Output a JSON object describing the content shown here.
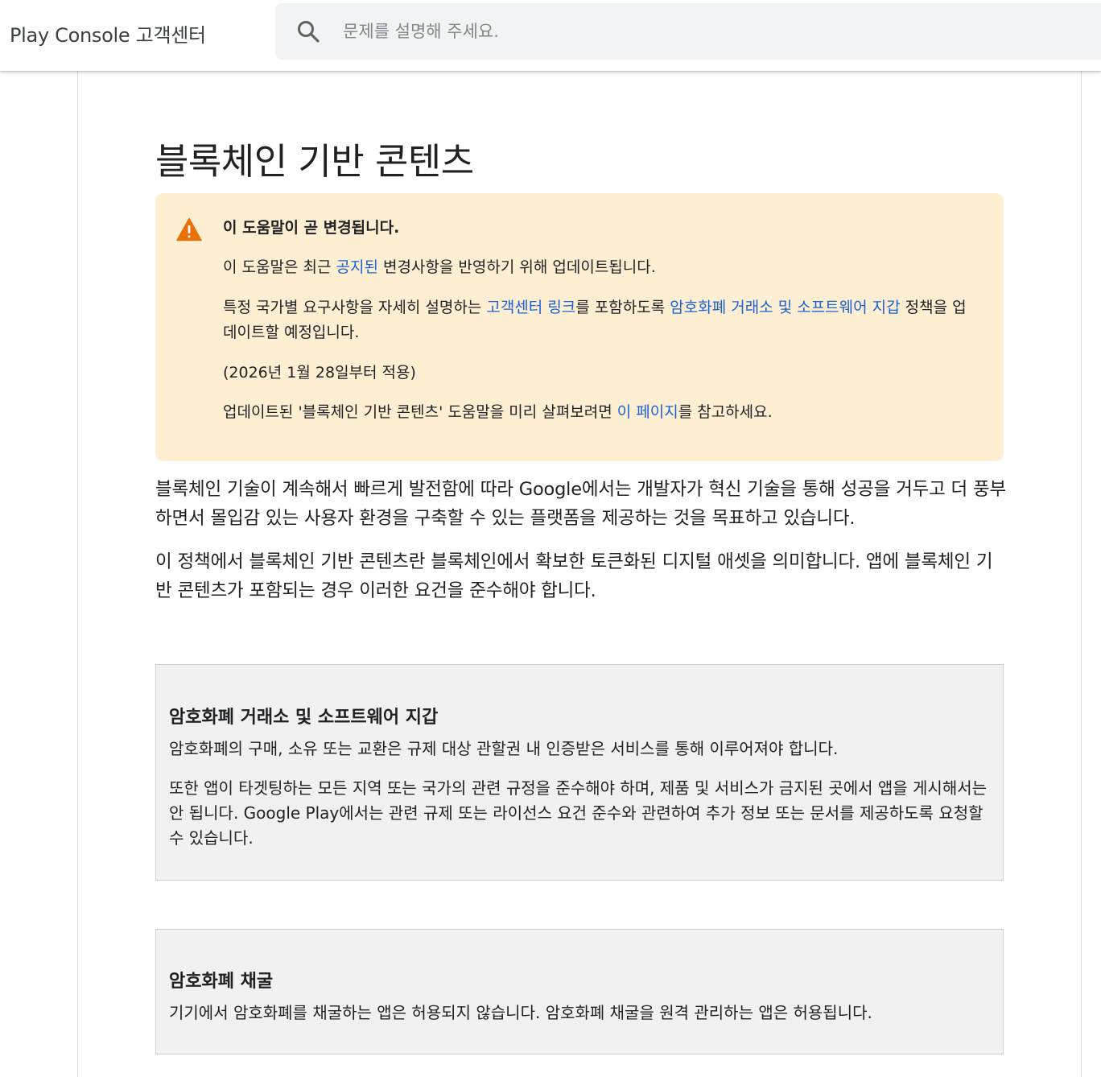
{
  "header": {
    "app_title": "Play Console 고객센터",
    "search_placeholder": "문제를 설명해 주세요."
  },
  "article": {
    "title": "블록체인 기반 콘텐츠",
    "notice": {
      "heading": "이 도움말이 곧 변경됩니다.",
      "line1_pre": "이 도움말은 최근 ",
      "line1_link": "공지된",
      "line1_post": " 변경사항을 반영하기 위해 업데이트됩니다.",
      "line2_pre": "특정 국가별 요구사항을 자세히 설명하는 ",
      "line2_link1": "고객센터 링크",
      "line2_mid": "를 포함하도록 ",
      "line2_link2": "암호화폐 거래소 및 소프트웨어 지갑",
      "line2_post": " 정책을 업데이트할 예정입니다.",
      "line3": "(2026년 1월 28일부터 적용)",
      "line4_pre": "업데이트된 '블록체인 기반 콘텐츠' 도움말을 미리 살펴보려면 ",
      "line4_link": "이 페이지",
      "line4_post": "를 참고하세요.",
      "warning_icon": "warning-triangle-icon",
      "background_color": "#feefd2",
      "icon_color": "#e8710a"
    },
    "paragraph1": "블록체인 기술이 계속해서 빠르게 발전함에 따라 Google에서는 개발자가 혁신 기술을 통해 성공을 거두고 더 풍부하면서 몰입감 있는 사용자 환경을 구축할 수 있는 플랫폼을 제공하는 것을 목표하고 있습니다.",
    "paragraph2": "이 정책에서 블록체인 기반 콘텐츠란 블록체인에서 확보한 토큰화된 디지털 애셋을 의미합니다. 앱에 블록체인 기반 콘텐츠가 포함되는 경우 이러한 요건을 준수해야 합니다.",
    "sections": [
      {
        "title": "암호화폐 거래소 및 소프트웨어 지갑",
        "paragraphs": [
          "암호화폐의 구매, 소유 또는 교환은 규제 대상 관할권 내 인증받은 서비스를 통해 이루어져야 합니다.",
          "또한 앱이 타겟팅하는 모든 지역 또는 국가의 관련 규정을 준수해야 하며, 제품 및 서비스가 금지된 곳에서 앱을 게시해서는 안 됩니다. Google Play에서는 관련 규제 또는 라이선스 요건 준수와 관련하여 추가 정보 또는 문서를 제공하도록 요청할 수 있습니다."
        ]
      },
      {
        "title": "암호화폐 채굴",
        "paragraphs": [
          "기기에서 암호화폐를 채굴하는 앱은 허용되지 않습니다. 암호화폐 채굴을 원격 관리하는 앱은 허용됩니다."
        ]
      }
    ]
  },
  "colors": {
    "link": "#1a61d3",
    "section_background": "#f1f1f1"
  }
}
